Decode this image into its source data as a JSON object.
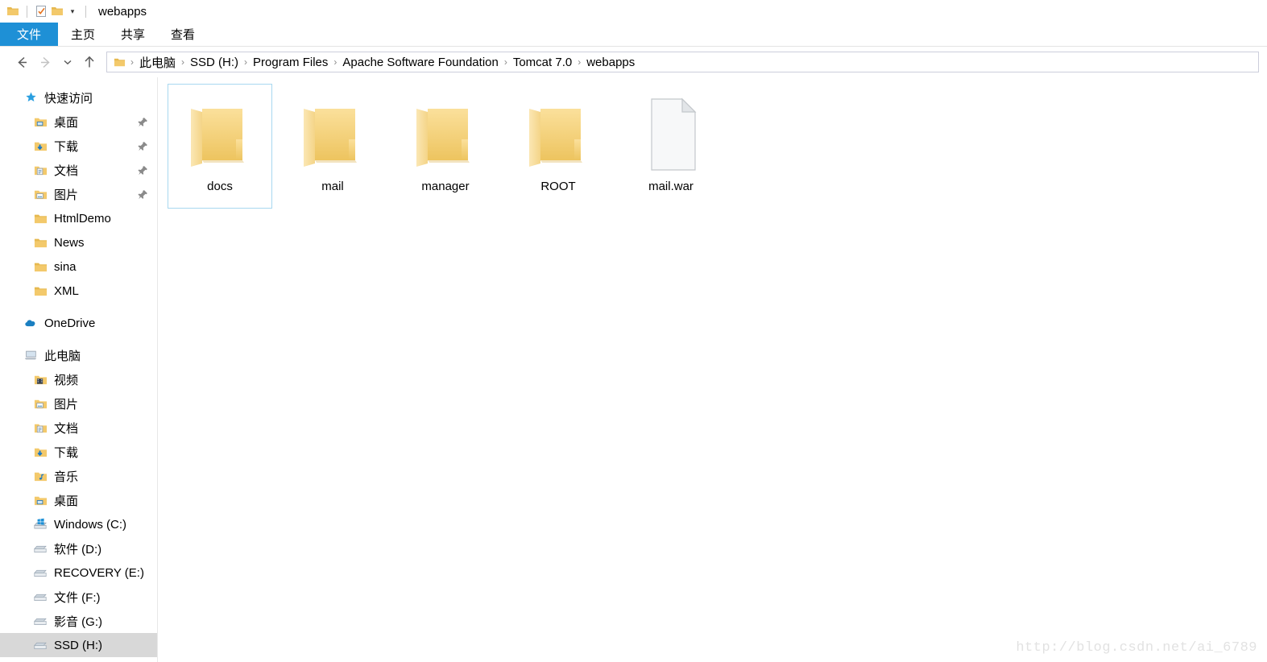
{
  "window": {
    "title": "webapps",
    "quick_access_toolbar": [
      {
        "icon": "folder-icon",
        "name": "qat-folder-icon"
      },
      {
        "icon": "properties-checkmark-icon",
        "name": "qat-properties-icon"
      },
      {
        "icon": "folder-icon",
        "name": "qat-new-folder-icon"
      }
    ],
    "customize_caret": "▾"
  },
  "ribbon": {
    "tabs": [
      {
        "label": "文件",
        "active": true
      },
      {
        "label": "主页",
        "active": false
      },
      {
        "label": "共享",
        "active": false
      },
      {
        "label": "查看",
        "active": false
      }
    ]
  },
  "navigation": {
    "back": {
      "label": "←",
      "enabled": true
    },
    "forward": {
      "label": "→",
      "enabled": false
    },
    "recent": {
      "label": "⌄",
      "enabled": true
    },
    "up": {
      "label": "↑",
      "enabled": true
    },
    "breadcrumb": [
      "此电脑",
      "SSD (H:)",
      "Program Files",
      "Apache Software Foundation",
      "Tomcat 7.0",
      "webapps"
    ],
    "separator": "›"
  },
  "sidebar": {
    "sections": [
      {
        "header": {
          "label": "快速访问",
          "icon": "star-icon"
        },
        "items": [
          {
            "label": "桌面",
            "icon": "desktop-folder-icon",
            "pinned": true
          },
          {
            "label": "下载",
            "icon": "downloads-folder-icon",
            "pinned": true
          },
          {
            "label": "文档",
            "icon": "documents-folder-icon",
            "pinned": true
          },
          {
            "label": "图片",
            "icon": "pictures-folder-icon",
            "pinned": true
          },
          {
            "label": "HtmlDemo",
            "icon": "folder-icon",
            "pinned": false
          },
          {
            "label": "News",
            "icon": "folder-icon",
            "pinned": false
          },
          {
            "label": "sina",
            "icon": "folder-icon",
            "pinned": false
          },
          {
            "label": "XML",
            "icon": "folder-icon",
            "pinned": false
          }
        ]
      },
      {
        "header": {
          "label": "OneDrive",
          "icon": "onedrive-cloud-icon"
        },
        "items": []
      },
      {
        "header": {
          "label": "此电脑",
          "icon": "this-pc-icon"
        },
        "items": [
          {
            "label": "视频",
            "icon": "videos-folder-icon",
            "pinned": false
          },
          {
            "label": "图片",
            "icon": "pictures-folder-icon",
            "pinned": false
          },
          {
            "label": "文档",
            "icon": "documents-folder-icon",
            "pinned": false
          },
          {
            "label": "下载",
            "icon": "downloads-folder-icon",
            "pinned": false
          },
          {
            "label": "音乐",
            "icon": "music-folder-icon",
            "pinned": false
          },
          {
            "label": "桌面",
            "icon": "desktop-folder-icon",
            "pinned": false
          },
          {
            "label": "Windows (C:)",
            "icon": "windows-drive-icon",
            "pinned": false
          },
          {
            "label": "软件 (D:)",
            "icon": "drive-icon",
            "pinned": false
          },
          {
            "label": "RECOVERY (E:)",
            "icon": "drive-icon",
            "pinned": false
          },
          {
            "label": "文件 (F:)",
            "icon": "drive-icon",
            "pinned": false
          },
          {
            "label": "影音 (G:)",
            "icon": "drive-icon",
            "pinned": false
          },
          {
            "label": "SSD (H:)",
            "icon": "drive-icon",
            "pinned": false,
            "selected": true
          }
        ]
      }
    ]
  },
  "content": {
    "items": [
      {
        "name": "docs",
        "type": "folder",
        "selected": true
      },
      {
        "name": "mail",
        "type": "folder",
        "selected": false
      },
      {
        "name": "manager",
        "type": "folder",
        "selected": false
      },
      {
        "name": "ROOT",
        "type": "folder",
        "selected": false
      },
      {
        "name": "mail.war",
        "type": "file",
        "selected": false
      }
    ]
  },
  "watermark": {
    "text": "http://blog.csdn.net/ai_6789"
  },
  "colors": {
    "accent": "#1e90d6",
    "folder": "#f5d278",
    "selection_border": "#a8d8f0",
    "sidebar_selection": "#d8d8d8",
    "watermark": "#e2e2e2"
  }
}
